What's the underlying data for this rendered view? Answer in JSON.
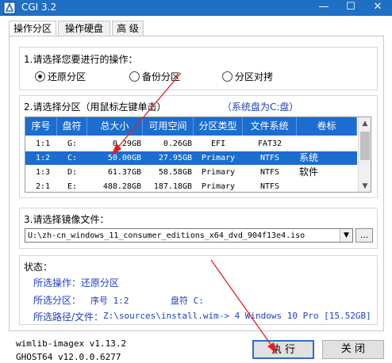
{
  "window": {
    "title": "CGI 3.2"
  },
  "tabs": [
    {
      "label": "操作分区",
      "active": true
    },
    {
      "label": "操作硬盘",
      "active": false
    },
    {
      "label": "高 级",
      "active": false
    }
  ],
  "operation": {
    "title": "1.请选择您要进行的操作：",
    "options": [
      {
        "label": "还原分区",
        "selected": true
      },
      {
        "label": "备份分区",
        "selected": false
      },
      {
        "label": "分区对拷",
        "selected": false
      }
    ]
  },
  "partition": {
    "title": "2.请选择分区（用鼠标左键单击）",
    "system_note": "（系统盘为C:盘）",
    "columns": [
      "序号",
      "盘符",
      "总大小",
      "可用空间",
      "分区类型",
      "文件系统",
      "卷标"
    ],
    "rows": [
      [
        "1:1",
        "G:",
        "0.29GB",
        "0.26GB",
        "EFI",
        "FAT32",
        ""
      ],
      [
        "1:2",
        "C:",
        "50.00GB",
        "27.95GB",
        "Primary",
        "NTFS",
        "系统"
      ],
      [
        "1:3",
        "D:",
        "61.37GB",
        "58.58GB",
        "Primary",
        "NTFS",
        "软件"
      ],
      [
        "2:1",
        "E:",
        "488.28GB",
        "187.18GB",
        "Primary",
        "NTFS",
        ""
      ]
    ],
    "selected_row": 1
  },
  "image_file": {
    "title": "3.请选择镜像文件：",
    "value": "U:\\zh-cn_windows_11_consumer_editions_x64_dvd_904f13e4.iso",
    "browse_label": "..."
  },
  "status": {
    "title": "状态：",
    "operation_line": "所选操作：还原分区",
    "partition_label": "所选分区：",
    "index_label": "序号 1:2",
    "drive_label": "盘符 C:",
    "path_label": "所选路径/文件：",
    "path_value": "Z:\\sources\\install.wim-> 4  Windows 10 Pro [15.52GB]"
  },
  "footer": {
    "wimlib": "wimlib-imagex v1.13.2",
    "ghost": "GHOST64 v12.0.0.6277"
  },
  "buttons": {
    "run": "执 行",
    "close": "关 闭"
  },
  "colors": {
    "titlebar": "#1f6fc4",
    "header": "#1c6dd0",
    "status_text": "#1c3fc4",
    "annotation_arrow": "#e02020"
  }
}
